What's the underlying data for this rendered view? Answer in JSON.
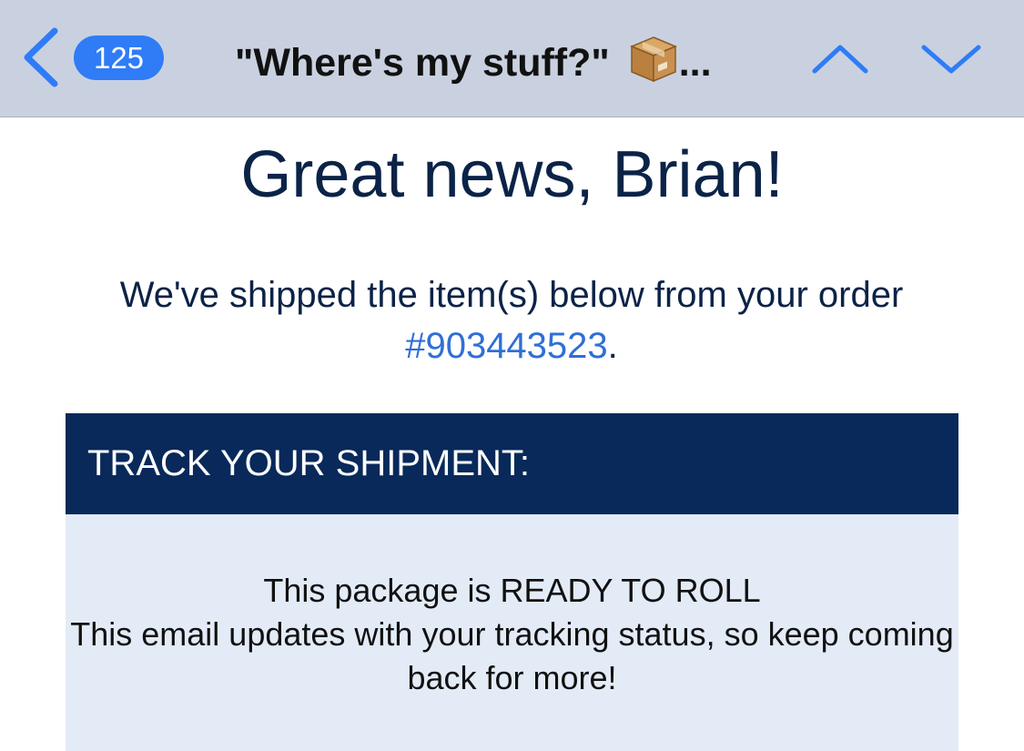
{
  "navbar": {
    "back_label": "Back",
    "unread_count": "125",
    "subject": "\"Where's my stuff?\" ",
    "subject_ellipsis": "...",
    "subject_icon": "package-icon",
    "prev_icon": "chevron-up-icon",
    "next_icon": "chevron-down-icon",
    "colors": {
      "bar_background": "#c9d1e0",
      "accent": "#2f7cf6"
    }
  },
  "email": {
    "greeting": "Great news, Brian!",
    "intro_text": "We've shipped the item(s) below from your order ",
    "order_link": "#903443523",
    "intro_suffix": ".",
    "track_header": "TRACK YOUR SHIPMENT:",
    "status_line1": "This package is READY TO ROLL",
    "status_line2": "This email updates with your tracking status, so keep coming back for more!",
    "colors": {
      "heading_text": "#0b2347",
      "link": "#2f6fd6",
      "header_band": "#08295a",
      "status_panel": "#e3ebf7"
    }
  }
}
